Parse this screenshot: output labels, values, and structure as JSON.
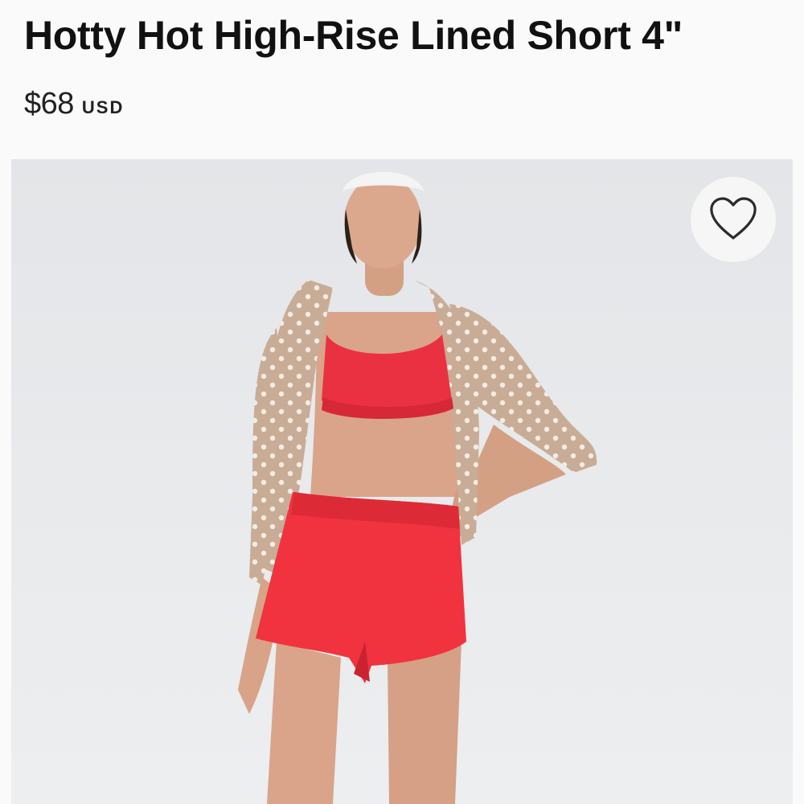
{
  "product": {
    "title": "Hotty Hot High-Rise Lined Short 4\"",
    "price": "$68",
    "currency": "USD"
  },
  "photo": {
    "background_color": "#e6e8ea",
    "short_color": "#f0333e",
    "bra_color": "#ea3141",
    "jacket_color": "#c9ae98"
  },
  "favorite": {
    "icon": "heart-outline-icon"
  }
}
